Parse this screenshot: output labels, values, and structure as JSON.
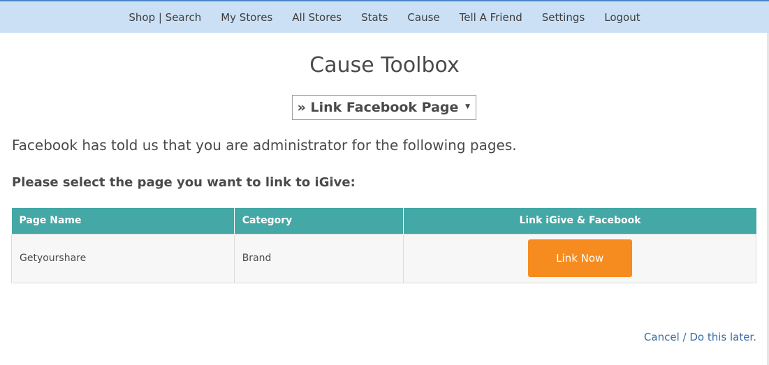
{
  "nav": {
    "items": [
      {
        "label": "Shop | Search"
      },
      {
        "label": "My Stores"
      },
      {
        "label": "All Stores"
      },
      {
        "label": "Stats"
      },
      {
        "label": "Cause"
      },
      {
        "label": "Tell A Friend"
      },
      {
        "label": "Settings"
      },
      {
        "label": "Logout"
      }
    ]
  },
  "main": {
    "title": "Cause Toolbox",
    "toolbox_select": {
      "selected": "» Link Facebook Page",
      "arrow": "▼"
    },
    "intro": "Facebook has told us that you are administrator for the following pages.",
    "prompt": "Please select the page you want to link to iGive:",
    "table": {
      "headers": [
        "Page Name",
        "Category",
        "Link iGive & Facebook"
      ],
      "rows": [
        {
          "page_name": "Getyourshare",
          "category": "Brand",
          "action": "Link Now"
        }
      ]
    },
    "cancel": "Cancel / Do this later."
  },
  "colors": {
    "nav_bg": "#cce0f5",
    "header_teal": "#43a8a6",
    "button_orange": "#f68b1f",
    "link_blue": "#3a6ea5"
  }
}
